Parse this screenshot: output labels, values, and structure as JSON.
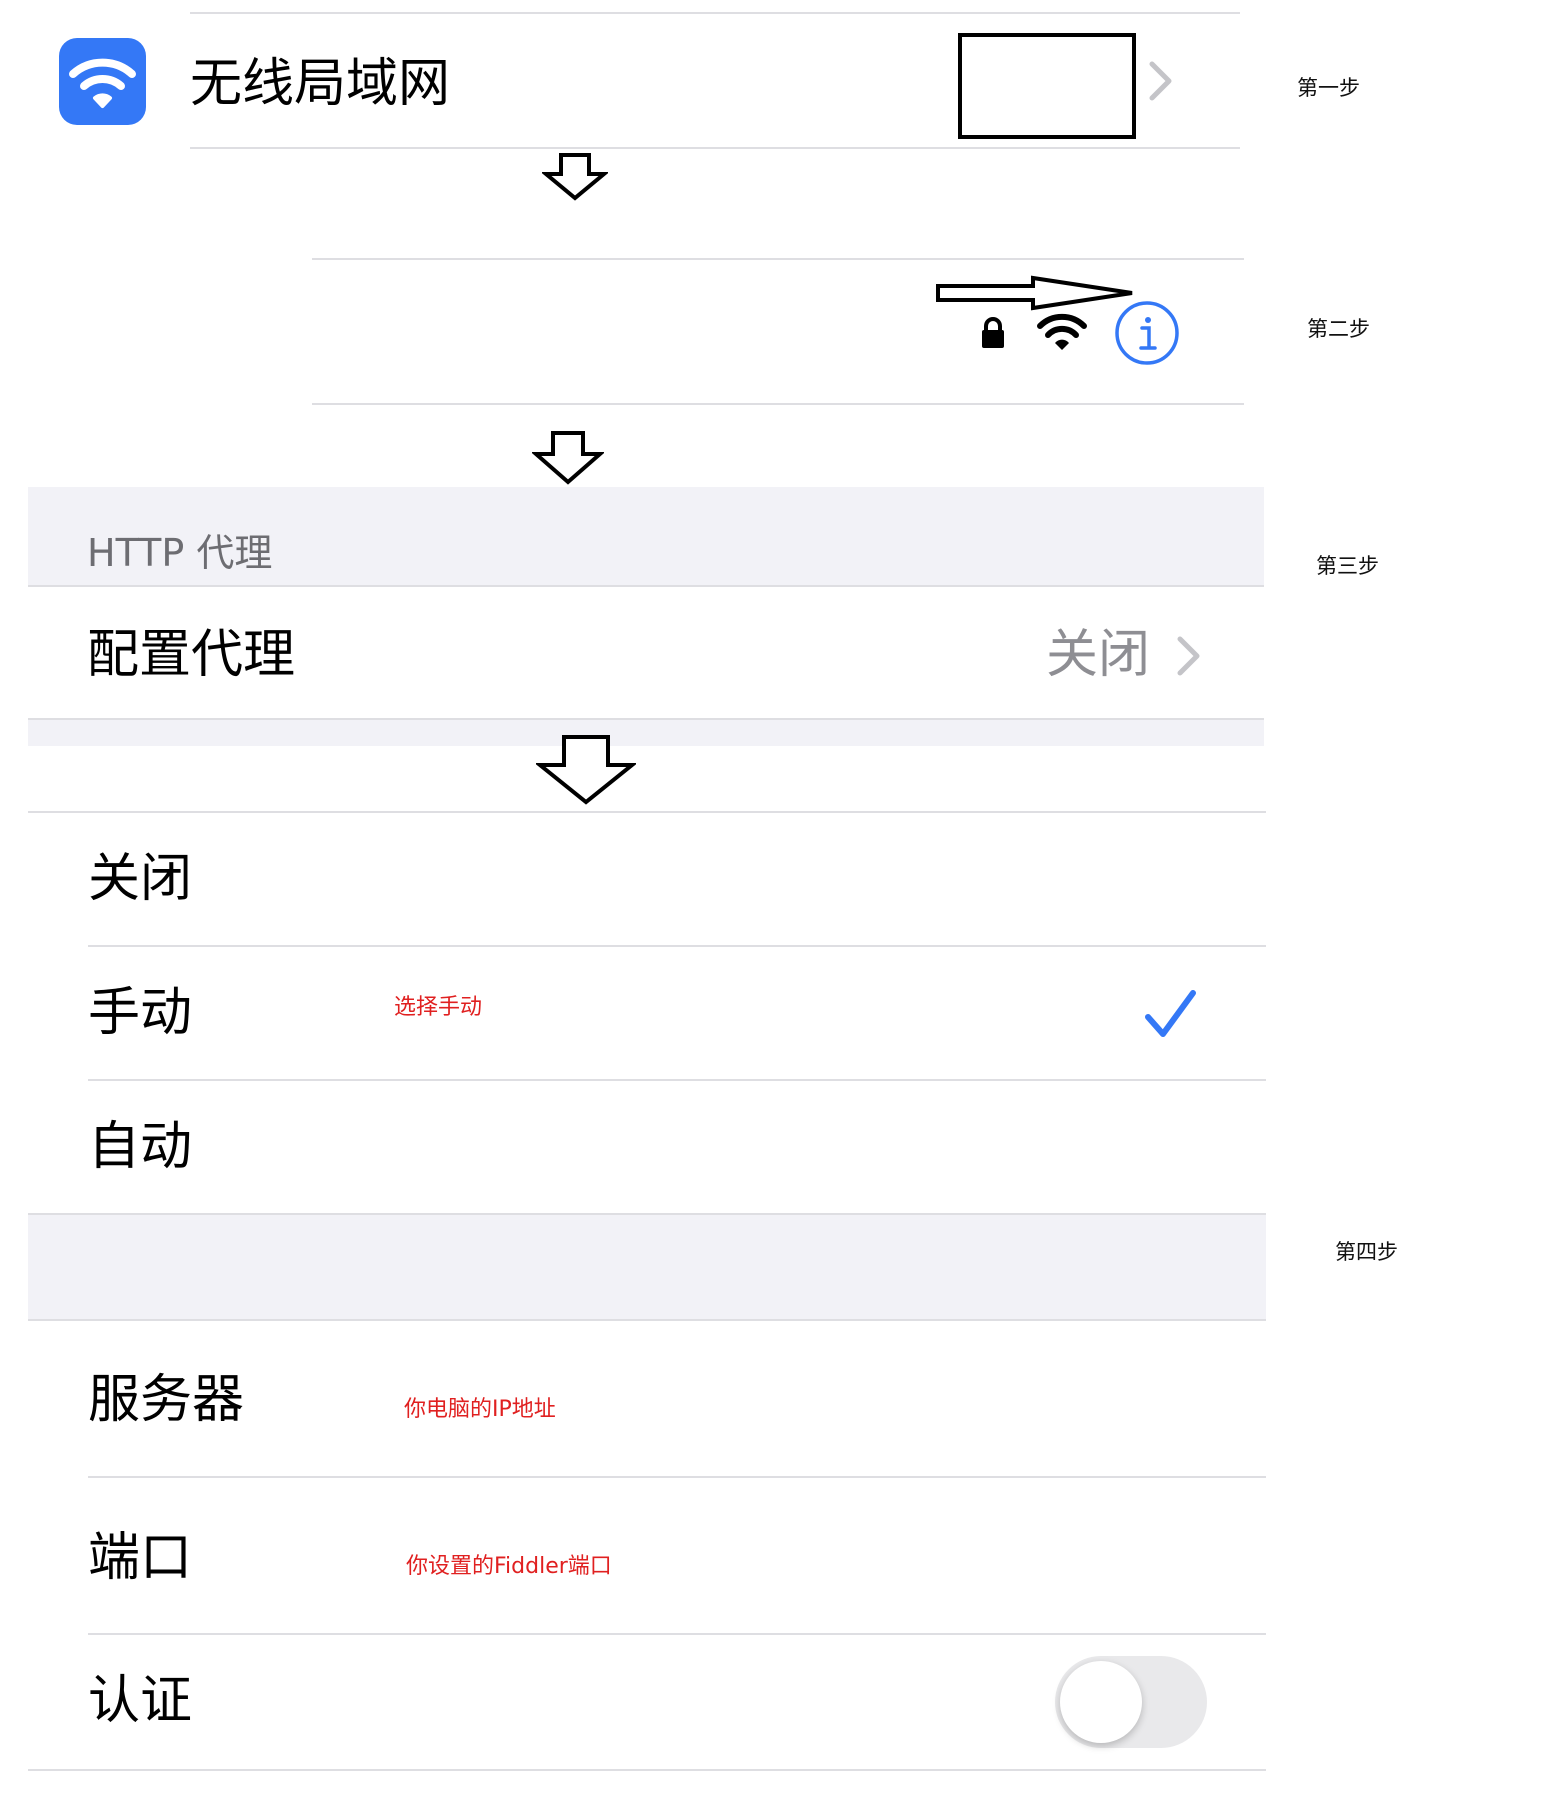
{
  "steps": {
    "step1": "第一步",
    "step2": "第二步",
    "step3": "第三步",
    "step4": "第四步"
  },
  "wifi_row": {
    "label": "无线局域网",
    "icon": "wifi-icon",
    "icon_color": "#3478f6"
  },
  "network_row": {
    "icons": [
      "lock-icon",
      "wifi-signal-icon",
      "info-icon"
    ],
    "info_color": "#3478f6"
  },
  "http_proxy": {
    "section_header": "HTTP 代理",
    "row_label": "配置代理",
    "row_value": "关闭"
  },
  "proxy_options": {
    "items": [
      {
        "label": "关闭",
        "selected": false
      },
      {
        "label": "手动",
        "selected": true
      },
      {
        "label": "自动",
        "selected": false
      }
    ],
    "note": "选择手动",
    "check_color": "#3478f6"
  },
  "manual_settings": {
    "server_label": "服务器",
    "server_note": "你电脑的IP地址",
    "port_label": "端口",
    "port_note": "你设置的Fiddler端口",
    "auth_label": "认证",
    "auth_enabled": false
  }
}
